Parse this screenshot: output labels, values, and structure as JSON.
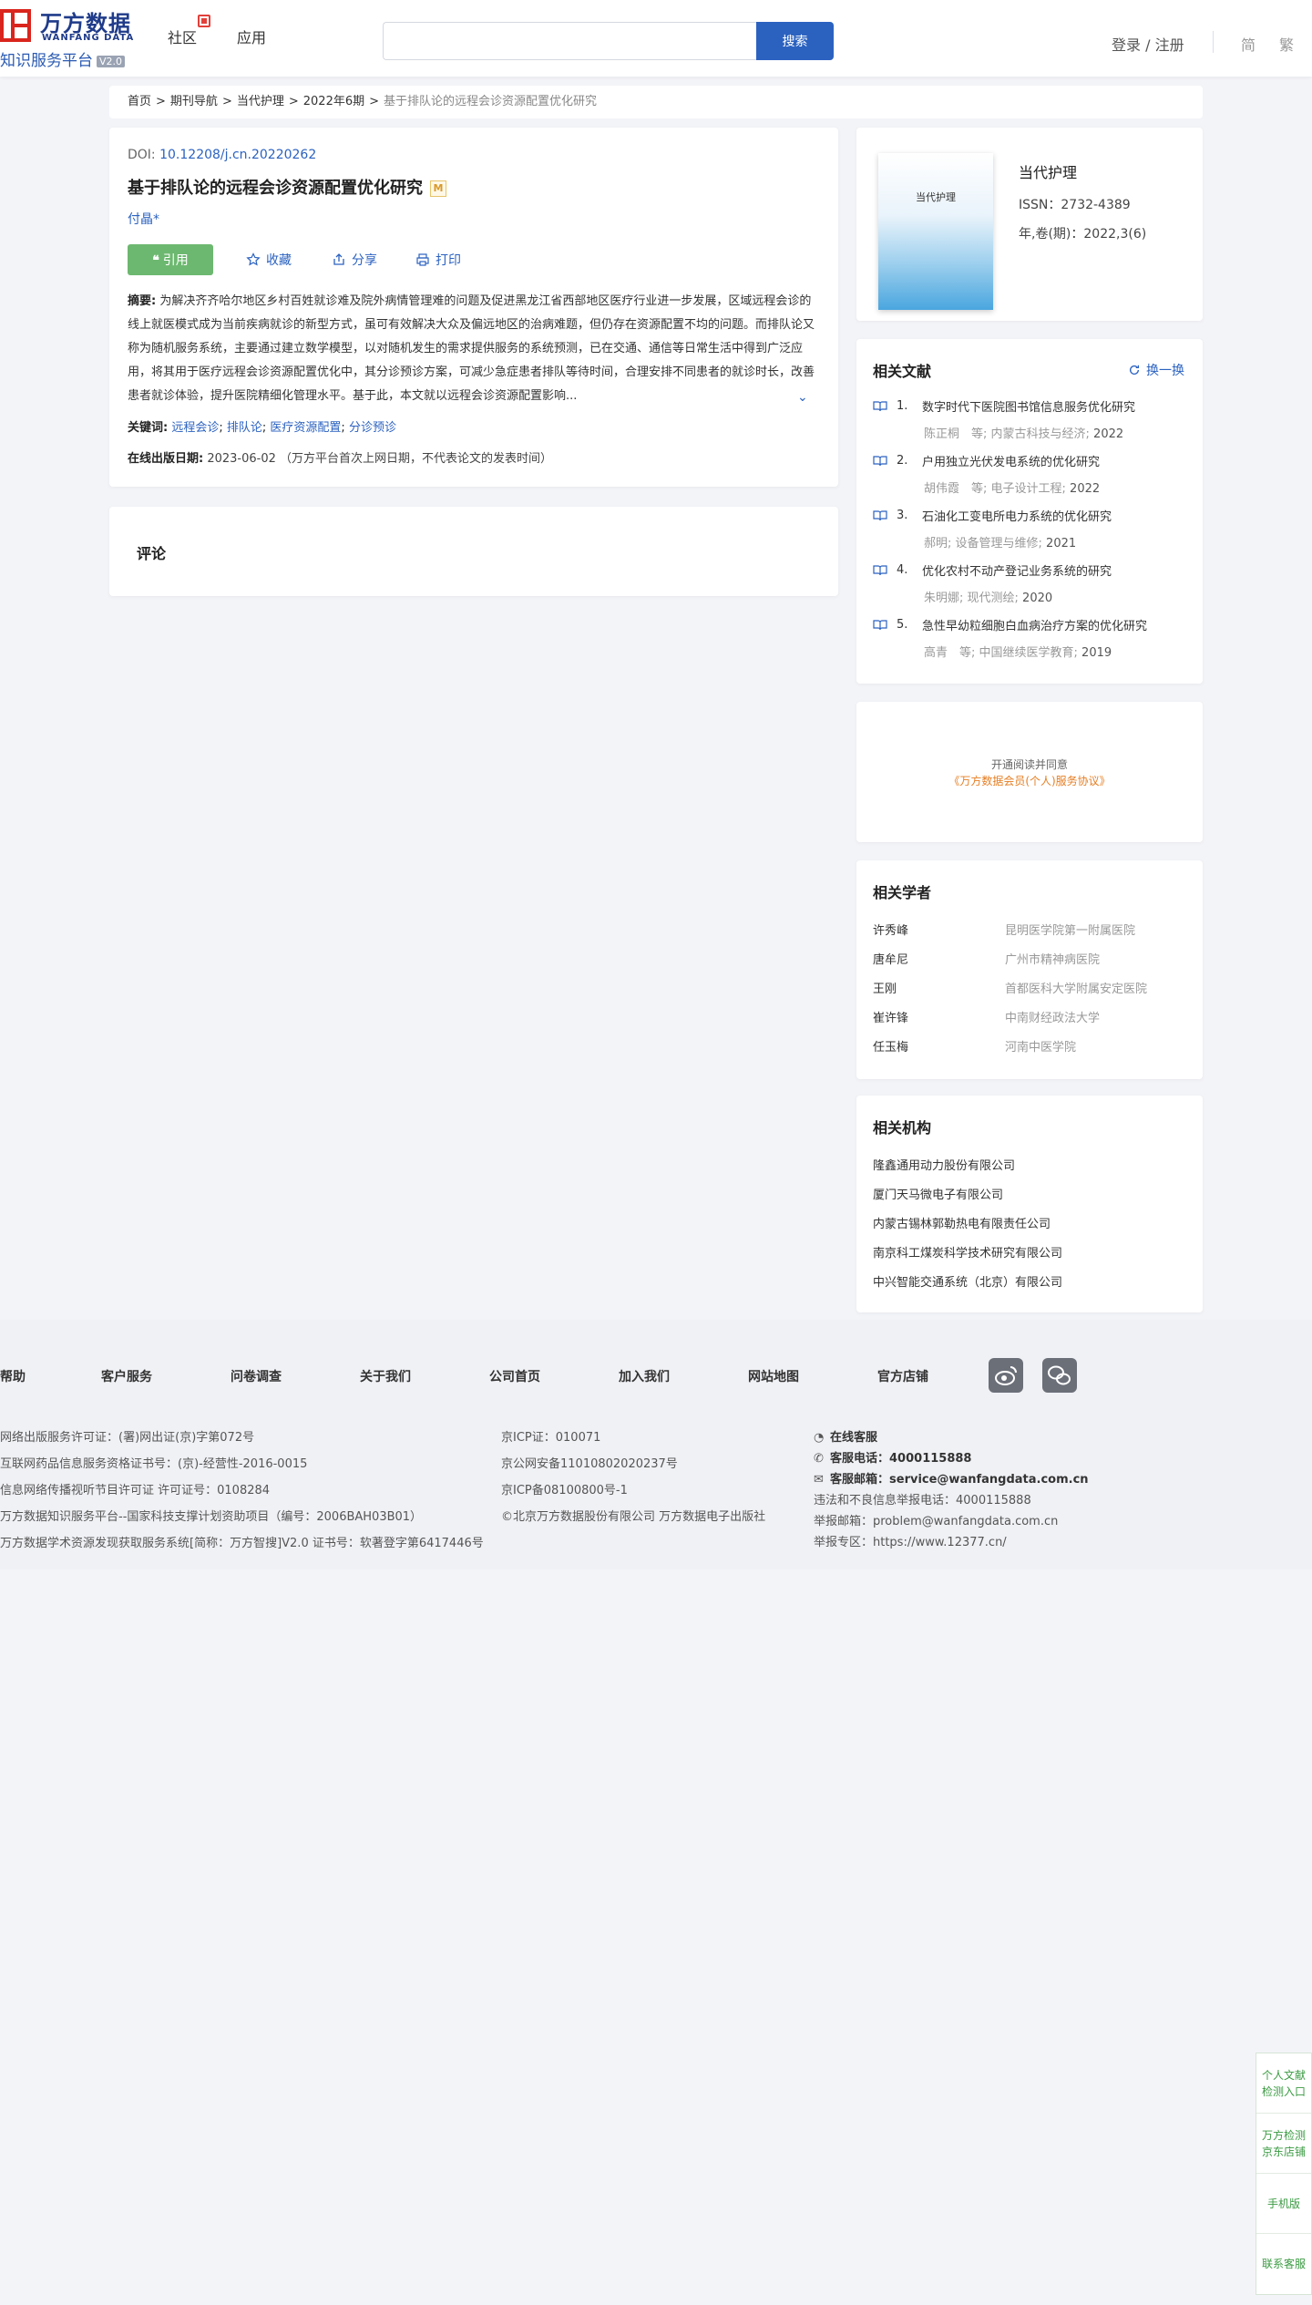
{
  "header": {
    "logo_cn": "万方数据",
    "logo_en": "WANFANG DATA",
    "logo_sub": "知识服务平台",
    "logo_ver": "V2.0",
    "nav": [
      "社区",
      "应用"
    ],
    "search_placeholder": "",
    "search_button": "搜索",
    "login": "登录 / 注册",
    "lang_simple": "简",
    "lang_trad": "繁"
  },
  "breadcrumb": {
    "items": [
      "首页",
      "期刊导航",
      "当代护理",
      "2022年6期"
    ],
    "current": "基于排队论的远程会诊资源配置优化研究"
  },
  "article": {
    "doi_label": "DOI: ",
    "doi": "10.12208/j.cn.20220262",
    "title": "基于排队论的远程会诊资源配置优化研究",
    "badge": "M",
    "author": "付晶*",
    "actions": {
      "cite": "引用",
      "collect": "收藏",
      "share": "分享",
      "print": "打印"
    },
    "abstract_label": "摘要:",
    "abstract": "为解决齐齐哈尔地区乡村百姓就诊难及院外病情管理难的问题及促进黑龙江省西部地区医疗行业进一步发展，区域远程会诊的线上就医模式成为当前疾病就诊的新型方式，虽可有效解决大众及偏远地区的治病难题，但仍存在资源配置不均的问题。而排队论又称为随机服务系统，主要通过建立数学模型，以对随机发生的需求提供服务的系统预测，已在交通、通信等日常生活中得到广泛应用，将其用于医疗远程会诊资源配置优化中，其分诊预诊方案，可减少急症患者排队等待时间，合理安排不同患者的就诊时长，改善患者就诊体验，提升医院精细化管理水平。基于此，本文就以远程会诊资源配置影响...",
    "keywords_label": "关键词:",
    "keywords": [
      "远程会诊",
      "排队论",
      "医疗资源配置",
      "分诊预诊"
    ],
    "online_date_label": "在线出版日期:",
    "online_date": "2023-06-02",
    "online_date_note": "（万方平台首次上网日期，不代表论文的发表时间）"
  },
  "comment": {
    "title": "评论"
  },
  "journal": {
    "cover_title": "当代护理",
    "name": "当代护理",
    "issn": "ISSN：2732-4389",
    "vol": "年,卷(期)：2022,3(6)"
  },
  "related_docs": {
    "title": "相关文献",
    "refresh": "换一换",
    "items": [
      {
        "num": "1.",
        "title": "数字时代下医院图书馆信息服务优化研究",
        "meta": "陈正桐　等;  内蒙古科技与经济;",
        "year": "2022"
      },
      {
        "num": "2.",
        "title": "户用独立光伏发电系统的优化研究",
        "meta": "胡伟霞　等;  电子设计工程;",
        "year": "2022"
      },
      {
        "num": "3.",
        "title": "石油化工变电所电力系统的优化研究",
        "meta": "郝明;  设备管理与维修;",
        "year": "2021"
      },
      {
        "num": "4.",
        "title": "优化农村不动产登记业务系统的研究",
        "meta": "朱明娜;  现代测绘;",
        "year": "2020"
      },
      {
        "num": "5.",
        "title": "急性早幼粒细胞白血病治疗方案的优化研究",
        "meta": "高青　等;  中国继续医学教育;",
        "year": "2019"
      }
    ]
  },
  "promo": {
    "line1": "开通阅读并同意",
    "line2": "《万方数据会员(个人)服务协议》"
  },
  "scholars": {
    "title": "相关学者",
    "items": [
      {
        "name": "许秀峰",
        "org": "昆明医学院第一附属医院"
      },
      {
        "name": "唐牟尼",
        "org": "广州市精神病医院"
      },
      {
        "name": "王刚",
        "org": "首都医科大学附属安定医院"
      },
      {
        "name": "崔许锋",
        "org": "中南财经政法大学"
      },
      {
        "name": "任玉梅",
        "org": "河南中医学院"
      }
    ]
  },
  "orgs": {
    "title": "相关机构",
    "items": [
      "隆鑫通用动力股份有限公司",
      "厦门天马微电子有限公司",
      "内蒙古锡林郭勒热电有限责任公司",
      "南京科工煤炭科学技术研究有限公司",
      "中兴智能交通系统（北京）有限公司"
    ]
  },
  "footer": {
    "links": [
      "帮助",
      "客户服务",
      "问卷调查",
      "关于我们",
      "公司首页",
      "加入我们",
      "网站地图",
      "官方店铺"
    ],
    "col1": [
      "网络出版服务许可证：(署)网出证(京)字第072号",
      "互联网药品信息服务资格证书号：(京)-经营性-2016-0015",
      "信息网络传播视听节目许可证 许可证号：0108284",
      "万方数据知识服务平台--国家科技支撑计划资助项目（编号：2006BAH03B01）",
      "万方数据学术资源发现获取服务系统[简称：万方智搜]V2.0 证书号：软著登字第6417446号"
    ],
    "col2": [
      "京ICP证：010071",
      "京公网安备11010802020237号",
      "京ICP备08100800号-1",
      "©北京万方数据股份有限公司 万方数据电子出版社"
    ],
    "online_service": "在线客服",
    "phone_label": "客服电话：",
    "phone": "4000115888",
    "email_label": "客服邮箱：",
    "email": "service@wanfangdata.com.cn",
    "report_phone": "违法和不良信息举报电话：4000115888",
    "report_email": "举报邮箱：problem@wanfangdata.com.cn",
    "report_zone": "举报专区：https://www.12377.cn/"
  },
  "float": [
    "个人文献检测入口",
    "万方检测京东店铺",
    "手机版",
    "联系客服"
  ]
}
